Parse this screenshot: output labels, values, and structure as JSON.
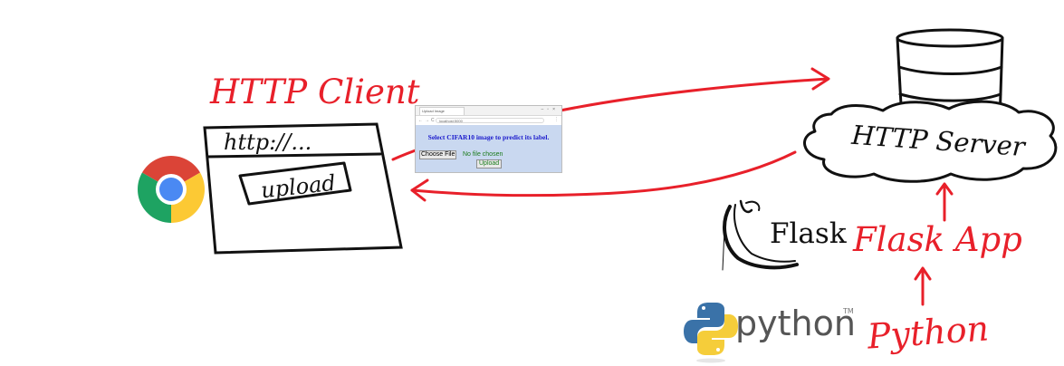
{
  "diagram": {
    "client": {
      "title": "HTTP Client",
      "url_text": "http://...",
      "button_text": "upload",
      "browser_icon": "chrome-icon"
    },
    "embedded_page": {
      "tab_title": "Upload Image",
      "address": "localhost:5000",
      "heading": "Select CIFAR10 image to predict its label.",
      "choose_file_label": "Choose File",
      "no_file_text": "No file chosen",
      "upload_label": "Upload"
    },
    "server": {
      "label": "HTTP Server",
      "database_icon": "database-icon"
    },
    "flask": {
      "logo_text": "Flask",
      "app_label": "Flask App",
      "logo_icon": "flask-horn-icon"
    },
    "python": {
      "logo_text": "python",
      "trademark": "TM",
      "handwritten_label": "Python",
      "logo_icon": "python-snake-icon"
    },
    "colors": {
      "ink": "#111111",
      "red": "#e8202a",
      "page_bg": "#c9d8f0",
      "link_blue": "#1a1acc",
      "python_blue": "#3a72a8",
      "python_yellow": "#f5cd3a"
    }
  }
}
